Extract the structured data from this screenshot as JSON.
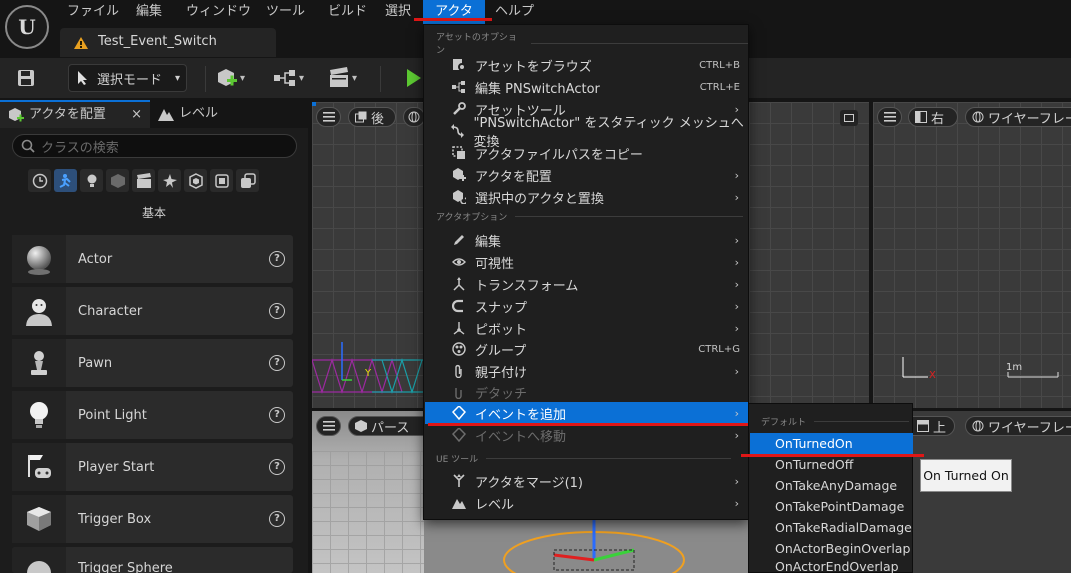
{
  "menubar": {
    "items": [
      "ファイル",
      "編集",
      "ウィンドウ",
      "ツール",
      "ビルド",
      "選択",
      "アクタ",
      "ヘルプ"
    ],
    "active": "アクタ"
  },
  "tab": {
    "title": "Test_Event_Switch"
  },
  "toolbar": {
    "mode_label": "選択モード"
  },
  "left_panel": {
    "tab_place": "アクタを配置",
    "tab_close": "×",
    "tab_level": "レベル",
    "search_placeholder": "クラスの検索",
    "section": "基本",
    "items": [
      "Actor",
      "Character",
      "Pawn",
      "Point Light",
      "Player Start",
      "Trigger Box",
      "Trigger Sphere"
    ]
  },
  "viewports": {
    "back": "後",
    "right": "右",
    "wire": "ワイヤーフレー",
    "persp": "パース",
    "top": "上",
    "wire2": "ワイヤーフレー",
    "y_label": "Y",
    "x_label": "X",
    "scale": "1m"
  },
  "context_menu": {
    "sections": {
      "asset": "アセットのオプション",
      "actor": "アクタオプション",
      "ue": "UE ツール"
    },
    "asset_items": [
      {
        "icon": "browse-icon",
        "label": "アセットをブラウズ",
        "shortcut": "CTRL+B"
      },
      {
        "icon": "edit-blueprint-icon",
        "label": "編集 PNSwitchActor",
        "shortcut": "CTRL+E"
      },
      {
        "icon": "wrench-icon",
        "label": "アセットツール",
        "arrow": true
      },
      {
        "icon": "convert-icon",
        "label": "\"PNSwitchActor\" をスタティック メッシュへ変換"
      },
      {
        "icon": "copy-path-icon",
        "label": "アクタファイルパスをコピー"
      },
      {
        "icon": "place-actor-icon",
        "label": "アクタを配置",
        "arrow": true
      },
      {
        "icon": "replace-icon",
        "label": "選択中のアクタと置換",
        "arrow": true
      }
    ],
    "actor_items": [
      {
        "icon": "pencil-icon",
        "label": "編集",
        "arrow": true
      },
      {
        "icon": "eye-icon",
        "label": "可視性",
        "arrow": true
      },
      {
        "icon": "transform-icon",
        "label": "トランスフォーム",
        "arrow": true
      },
      {
        "icon": "snap-icon",
        "label": "スナップ",
        "arrow": true
      },
      {
        "icon": "pivot-icon",
        "label": "ピボット",
        "arrow": true
      },
      {
        "icon": "group-icon",
        "label": "グループ",
        "shortcut": "CTRL+G"
      },
      {
        "icon": "attach-icon",
        "label": "親子付け",
        "arrow": true
      },
      {
        "icon": "detach-icon",
        "label": "デタッチ",
        "disabled": true
      },
      {
        "icon": "add-event-icon",
        "label": "イベントを追加",
        "arrow": true,
        "highlight": true
      },
      {
        "icon": "goto-event-icon",
        "label": "イベントへ移動",
        "arrow": true,
        "disabled": true
      }
    ],
    "ue_items": [
      {
        "icon": "merge-icon",
        "label": "アクタをマージ(1)",
        "arrow": true
      },
      {
        "icon": "level-icon",
        "label": "レベル",
        "arrow": true
      }
    ],
    "arrow_char": "›"
  },
  "submenu": {
    "section": "デフォルト",
    "items": [
      "OnTurnedOn",
      "OnTurnedOff",
      "OnTakeAnyDamage",
      "OnTakePointDamage",
      "OnTakeRadialDamage",
      "OnActorBeginOverlap",
      "OnActorEndOverlap"
    ],
    "highlighted": "OnTurnedOn"
  },
  "tooltip": {
    "text": "On Turned On"
  },
  "colors": {
    "accent": "#0b70d6",
    "annotation_red": "#e01616",
    "play_green": "#5cc832"
  }
}
